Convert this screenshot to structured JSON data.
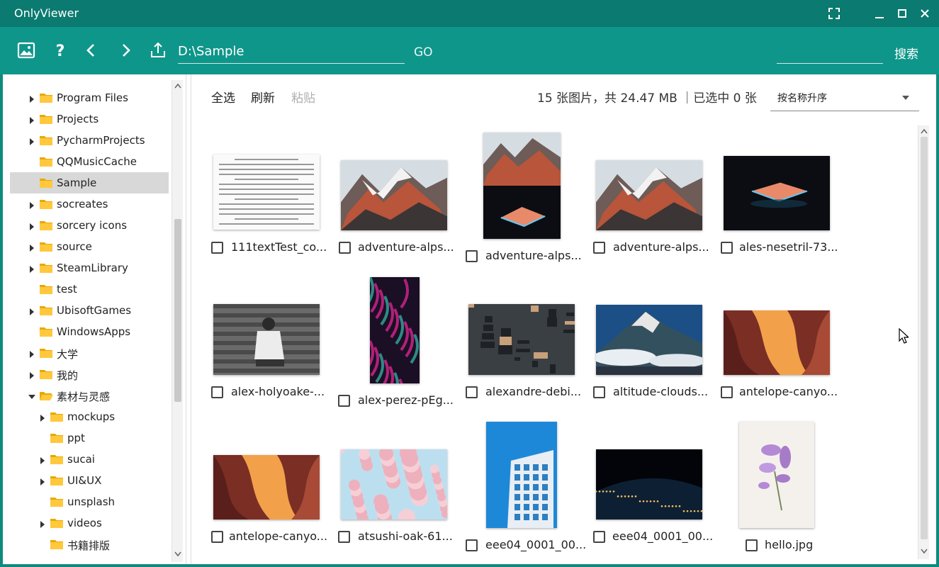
{
  "app": {
    "title": "OnlyViewer"
  },
  "toolbar": {
    "path_value": "D:\\Sample",
    "go_label": "GO",
    "search_label": "搜索",
    "search_value": ""
  },
  "tree": {
    "items": [
      {
        "label": "Program Files",
        "expandable": true,
        "level": 0
      },
      {
        "label": "Projects",
        "expandable": true,
        "level": 0
      },
      {
        "label": "PycharmProjects",
        "expandable": true,
        "level": 0
      },
      {
        "label": "QQMusicCache",
        "expandable": false,
        "level": 0
      },
      {
        "label": "Sample",
        "expandable": false,
        "level": 0,
        "selected": true
      },
      {
        "label": "socreates",
        "expandable": true,
        "level": 0
      },
      {
        "label": "sorcery icons",
        "expandable": true,
        "level": 0
      },
      {
        "label": "source",
        "expandable": true,
        "level": 0
      },
      {
        "label": "SteamLibrary",
        "expandable": true,
        "level": 0
      },
      {
        "label": "test",
        "expandable": false,
        "level": 0
      },
      {
        "label": "UbisoftGames",
        "expandable": true,
        "level": 0
      },
      {
        "label": "WindowsApps",
        "expandable": false,
        "level": 0
      },
      {
        "label": "大学",
        "expandable": true,
        "level": 0
      },
      {
        "label": "我的",
        "expandable": true,
        "level": 0
      },
      {
        "label": "素材与灵感",
        "expandable": true,
        "expanded": true,
        "level": 0
      },
      {
        "label": "mockups",
        "expandable": true,
        "level": 1
      },
      {
        "label": "ppt",
        "expandable": false,
        "level": 1
      },
      {
        "label": "sucai",
        "expandable": true,
        "level": 1
      },
      {
        "label": "UI&UX",
        "expandable": true,
        "level": 1
      },
      {
        "label": "unsplash",
        "expandable": false,
        "level": 1
      },
      {
        "label": "videos",
        "expandable": true,
        "level": 1
      },
      {
        "label": "书籍排版",
        "expandable": false,
        "level": 1
      }
    ]
  },
  "main": {
    "select_all_label": "全选",
    "refresh_label": "刷新",
    "paste_label": "粘贴",
    "status_text": "15 张图片，共 24.47 MB ｜已选中 0 张",
    "sort_value": "按名称升序",
    "files": [
      {
        "name": "111textTest_co...",
        "kind": "document"
      },
      {
        "name": "adventure-alps...",
        "kind": "mountain"
      },
      {
        "name": "adventure-alps...",
        "kind": "mountain-laptop"
      },
      {
        "name": "adventure-alps...",
        "kind": "mountain"
      },
      {
        "name": "ales-nesetril-73...",
        "kind": "laptop"
      },
      {
        "name": "alex-holyoake-...",
        "kind": "person-stairs"
      },
      {
        "name": "alex-perez-pEg...",
        "kind": "purple-fur"
      },
      {
        "name": "alexandre-debi...",
        "kind": "circuit"
      },
      {
        "name": "altitude-clouds...",
        "kind": "peak-clouds"
      },
      {
        "name": "antelope-canyo...",
        "kind": "canyon"
      },
      {
        "name": "antelope-canyo...",
        "kind": "canyon"
      },
      {
        "name": "atsushi-oak-61...",
        "kind": "blossom"
      },
      {
        "name": "eee04_0001_00...",
        "kind": "building"
      },
      {
        "name": "eee04_0001_00...",
        "kind": "earth-night"
      },
      {
        "name": "hello.jpg",
        "kind": "flower"
      }
    ]
  },
  "colors": {
    "titlebar": "#0b7a70",
    "toolbar": "#0f968a",
    "frame": "#0f8a7f",
    "folder": "#ffc83d"
  }
}
